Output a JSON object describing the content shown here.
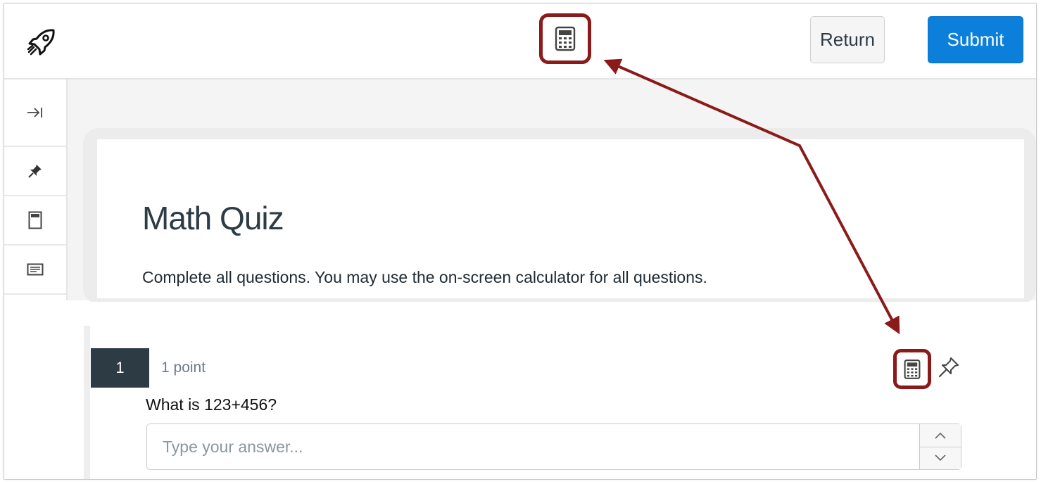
{
  "header": {
    "logo_icon": "rocket-icon",
    "calculator_icon": "calculator-icon",
    "return_label": "Return",
    "submit_label": "Submit"
  },
  "rail": {
    "items": [
      {
        "icon": "collapse-arrow-icon"
      },
      {
        "icon": "pin-icon"
      },
      {
        "icon": "document-icon"
      },
      {
        "icon": "text-lines-icon"
      }
    ]
  },
  "quiz": {
    "title": "Math Quiz",
    "description": "Complete all questions. You may use the on-screen calculator for all questions."
  },
  "question": {
    "number": "1",
    "points": "1 point",
    "text": "What is 123+456?",
    "answer_value": "",
    "answer_placeholder": "Type your answer...",
    "calculator_icon": "calculator-icon",
    "pin_icon": "pin-outline-icon"
  },
  "colors": {
    "annotation": "#8b1a1a",
    "submit_bg": "#0c7fdb",
    "question_number_bg": "#2d3b45"
  }
}
